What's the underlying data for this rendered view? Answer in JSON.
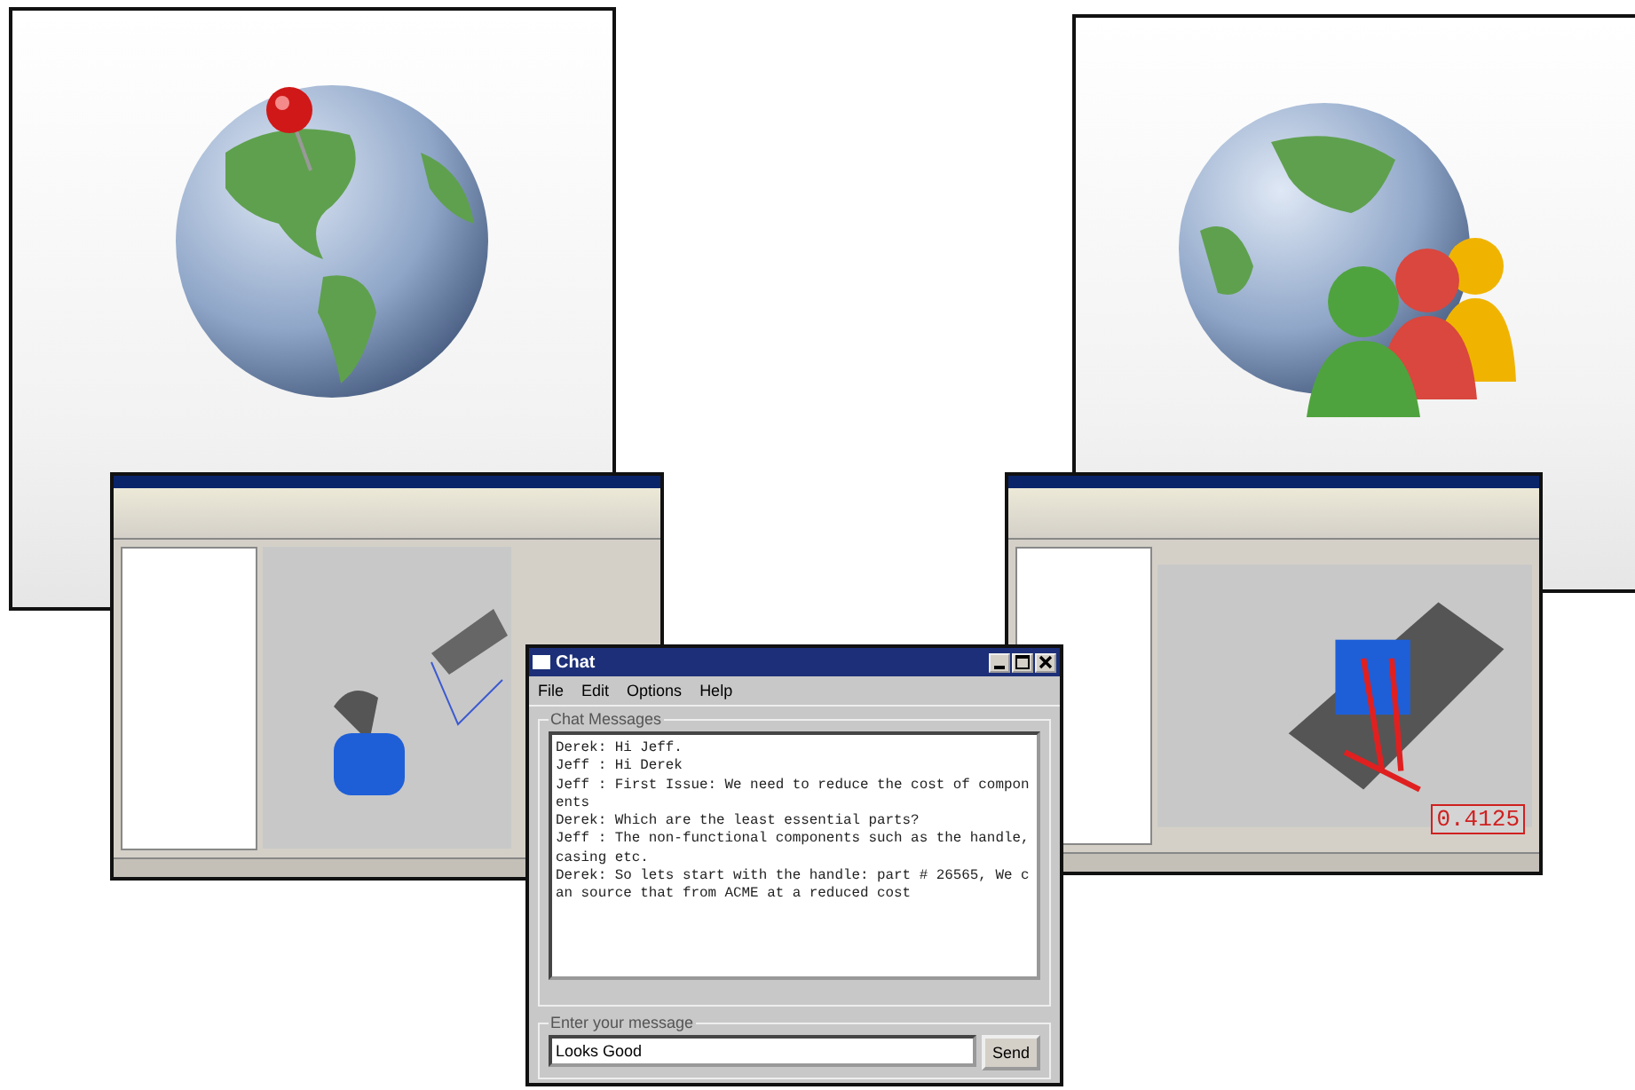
{
  "right_screenshot": {
    "dimension_label": "0.4125"
  },
  "chat": {
    "title": "Chat",
    "menu": [
      "File",
      "Edit",
      "Options",
      "Help"
    ],
    "messages_label": "Chat Messages",
    "messages": [
      "Derek: Hi Jeff.",
      "Jeff : Hi Derek",
      "Jeff : First Issue: We need to reduce the cost of components",
      "Derek: Which are the least essential parts?",
      "Jeff : The non-functional components such as the handle, casing etc.",
      "Derek: So lets start with the handle: part # 26565, We can source that from ACME at a reduced cost"
    ],
    "input_label": "Enter your message",
    "input_value": "Looks Good",
    "send_button": "Send"
  }
}
